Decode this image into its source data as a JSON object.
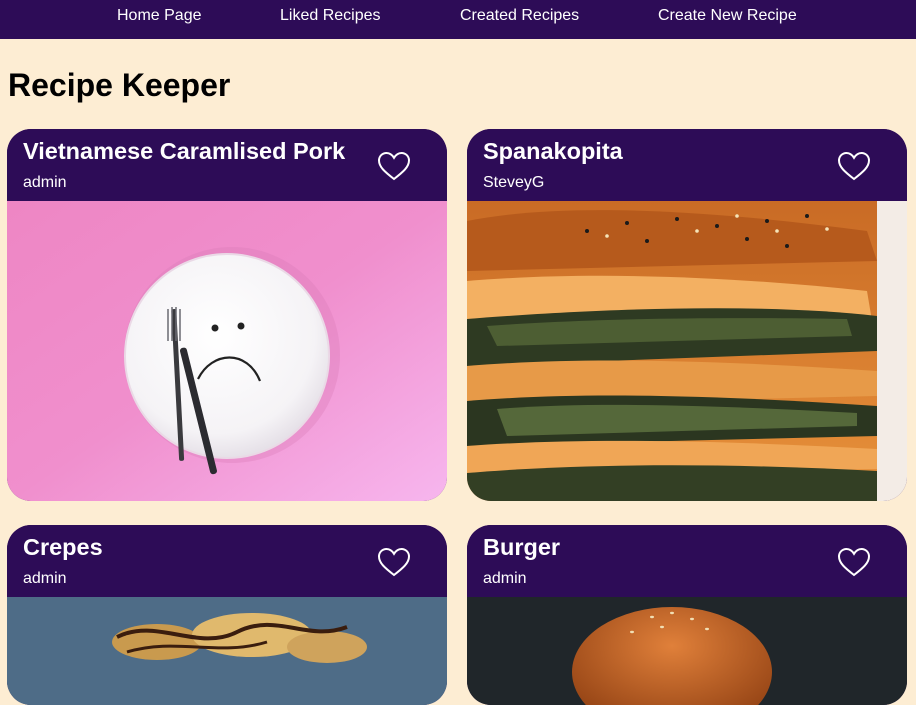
{
  "nav": {
    "links": [
      "Home Page",
      "Liked Recipes",
      "Created Recipes",
      "Create New Recipe"
    ]
  },
  "page": {
    "title": "Recipe Keeper"
  },
  "recipes": [
    {
      "title": "Vietnamese Caramlised Pork",
      "author": "admin",
      "image": "sad-plate-photo"
    },
    {
      "title": "Spanakopita",
      "author": "SteveyG",
      "image": "spanakopita-photo"
    },
    {
      "title": "Crepes",
      "author": "admin",
      "image": "crepes-photo"
    },
    {
      "title": "Burger",
      "author": "admin",
      "image": "burger-photo"
    }
  ],
  "colors": {
    "nav": "#2d0c57",
    "background": "#fdedd3",
    "card_header": "#2d0c57"
  }
}
